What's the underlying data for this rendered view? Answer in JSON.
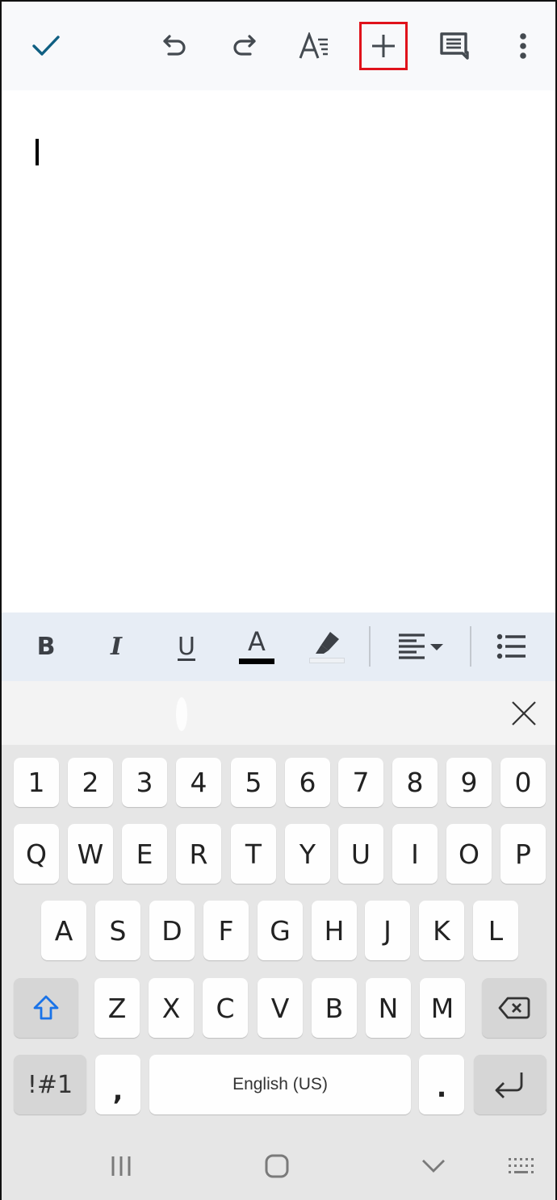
{
  "toolbar": {
    "icons": {
      "done": "check-icon",
      "undo": "undo-icon",
      "redo": "redo-icon",
      "text_format": "text-format-icon",
      "insert": "plus-icon",
      "comment": "comment-icon",
      "more": "more-vert-icon"
    },
    "accent_color": "#0f5f82",
    "highlighted_button": "insert",
    "highlight_color": "#e0121b"
  },
  "document": {
    "text": "",
    "cursor_visible": true
  },
  "format_bar": {
    "bold_label": "B",
    "italic_label": "I",
    "underline_label": "U",
    "text_color_label": "A",
    "text_color": "#000000",
    "highlight_icon": "highlighter-icon",
    "align_icon": "align-left-icon",
    "list_icon": "bulleted-list-icon"
  },
  "suggestion_strip": {
    "close_icon": "close-icon"
  },
  "keyboard": {
    "number_row": [
      "1",
      "2",
      "3",
      "4",
      "5",
      "6",
      "7",
      "8",
      "9",
      "0"
    ],
    "row1": [
      "Q",
      "W",
      "E",
      "R",
      "T",
      "Y",
      "U",
      "I",
      "O",
      "P"
    ],
    "row2": [
      "A",
      "S",
      "D",
      "F",
      "G",
      "H",
      "J",
      "K",
      "L"
    ],
    "row3": [
      "Z",
      "X",
      "C",
      "V",
      "B",
      "N",
      "M"
    ],
    "symbols_label": "!#1",
    "comma_label": ",",
    "space_label": "English (US)",
    "period_label": ".",
    "shift_color": "#1a73e8"
  },
  "navbar": {
    "icons": [
      "recents-icon",
      "home-icon",
      "back-icon",
      "keyboard-switch-icon"
    ]
  }
}
